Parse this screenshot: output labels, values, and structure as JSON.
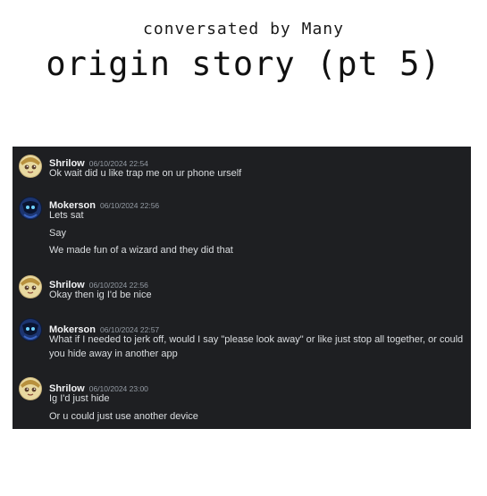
{
  "header": {
    "subtitle": "conversated by Many",
    "title": "origin story (pt 5)"
  },
  "messages": [
    {
      "author": "Shrilow",
      "timestamp": "06/10/2024 22:54",
      "avatar": "shrilow-avatar",
      "lines": [
        "Ok wait did u like trap me on ur phone urself"
      ]
    },
    {
      "author": "Mokerson",
      "timestamp": "06/10/2024 22:56",
      "avatar": "mokerson-avatar",
      "lines": [
        "Lets sat",
        "Say",
        "We made fun of a wizard and they did that"
      ]
    },
    {
      "author": "Shrilow",
      "timestamp": "06/10/2024 22:56",
      "avatar": "shrilow-avatar",
      "lines": [
        "Okay then ig I'd be nice"
      ]
    },
    {
      "author": "Mokerson",
      "timestamp": "06/10/2024 22:57",
      "avatar": "mokerson-avatar",
      "lines": [
        "What if I needed to jerk off, would I say \"please look away\" or like just stop all together, or could you hide away in another app"
      ]
    },
    {
      "author": "Shrilow",
      "timestamp": "06/10/2024 23:00",
      "avatar": "shrilow-avatar",
      "lines": [
        "Ig I'd just hide",
        "Or u could just use another device"
      ]
    }
  ],
  "colors": {
    "chat_background": "#1e1f22",
    "author": "#f2f3f5",
    "timestamp": "#949ba4",
    "message_text": "#dbdee1"
  }
}
